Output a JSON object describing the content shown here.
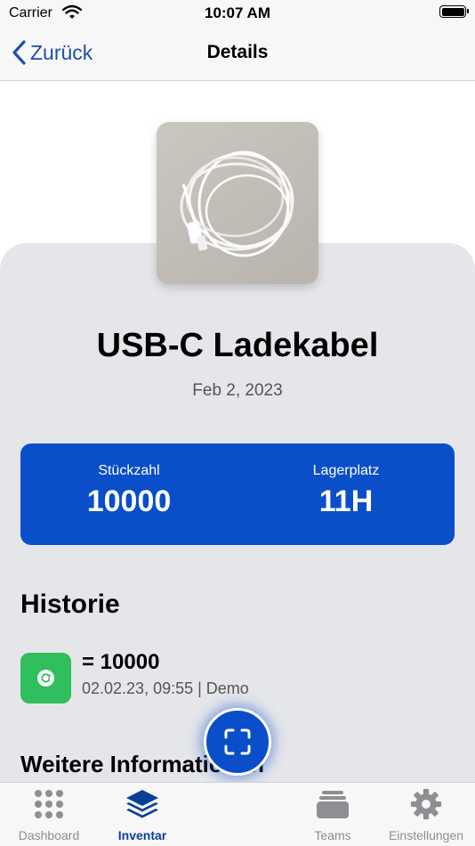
{
  "status_bar": {
    "carrier": "Carrier",
    "time": "10:07 AM"
  },
  "nav": {
    "back_label": "Zurück",
    "title": "Details"
  },
  "product": {
    "title": "USB-C Ladekabel",
    "date": "Feb 2, 2023"
  },
  "stats": {
    "quantity_label": "Stückzahl",
    "quantity_value": "10000",
    "location_label": "Lagerplatz",
    "location_value": "11H"
  },
  "history": {
    "title": "Historie",
    "entries": [
      {
        "value": "= 10000",
        "meta": "02.02.23, 09:55 | Demo",
        "icon": "refresh-icon"
      }
    ]
  },
  "more_info": {
    "title": "Weitere Informationen"
  },
  "tabs": [
    {
      "label": "Dashboard",
      "icon": "grid-icon",
      "active": false
    },
    {
      "label": "Inventar",
      "icon": "layers-icon",
      "active": true
    },
    {
      "label": "Teams",
      "icon": "tray-stack-icon",
      "active": false
    },
    {
      "label": "Einstellungen",
      "icon": "gear-icon",
      "active": false
    }
  ],
  "colors": {
    "primary": "#0a4ec9",
    "success": "#2fbf5c",
    "tab_active": "#0a3f99",
    "link": "#1f4fa8"
  }
}
